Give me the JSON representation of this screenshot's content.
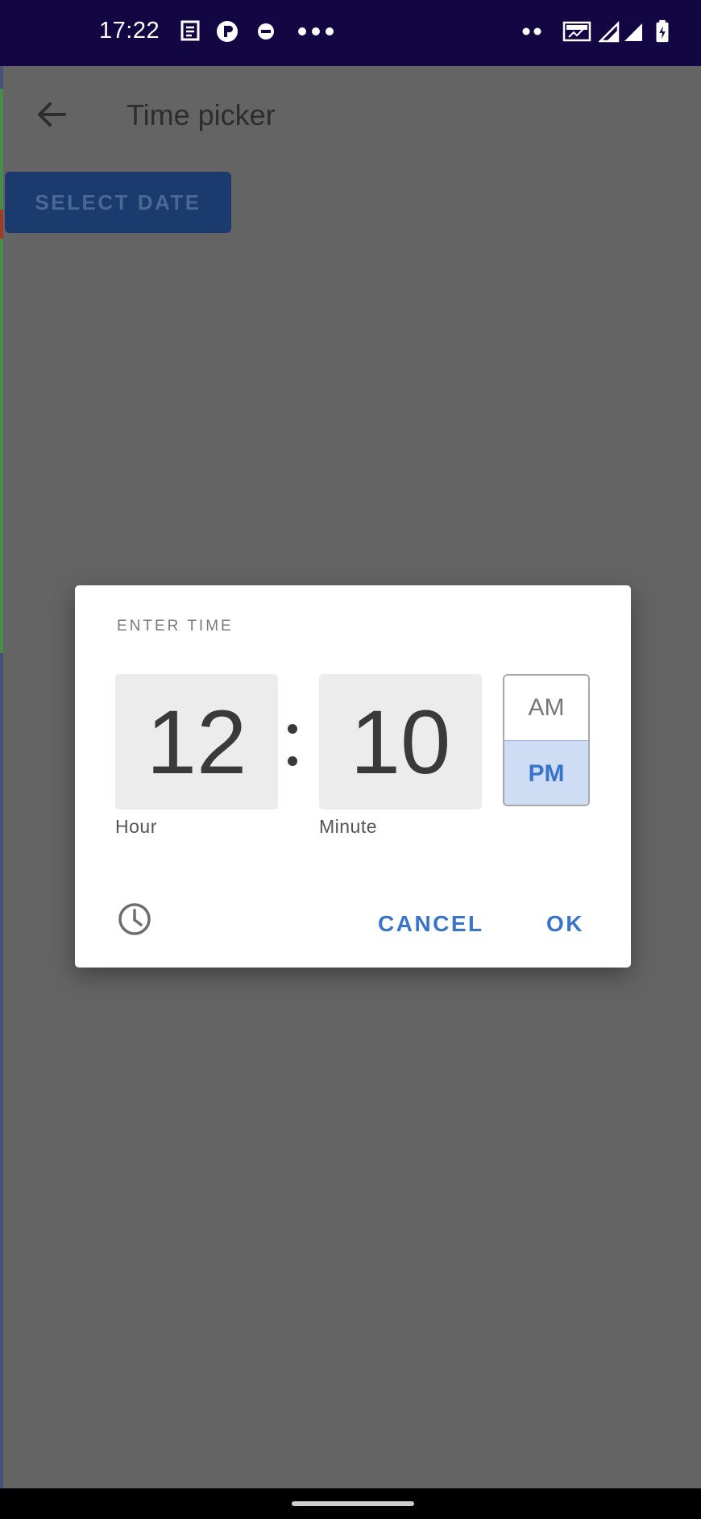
{
  "status_bar": {
    "time": "17:22",
    "icons": [
      "notes-icon",
      "p-app-icon",
      "minus-circle-icon",
      "more-dots-icon",
      "two-dots-icon",
      "volte-icon",
      "signal-icon",
      "signal-icon",
      "battery-icon"
    ]
  },
  "app_bar": {
    "title": "Time picker",
    "back_icon": "arrow-back-icon"
  },
  "select_date_button": "SELECT DATE",
  "dialog": {
    "label": "ENTER TIME",
    "hour": "12",
    "minute": "10",
    "hour_caption": "Hour",
    "minute_caption": "Minute",
    "am": "AM",
    "pm": "PM",
    "selected_period": "PM",
    "clock_icon": "clock-icon",
    "cancel": "CANCEL",
    "ok": "OK"
  },
  "colors": {
    "accent": "#3a74c8",
    "status_bar": "#120743",
    "scrim": "#646464"
  }
}
